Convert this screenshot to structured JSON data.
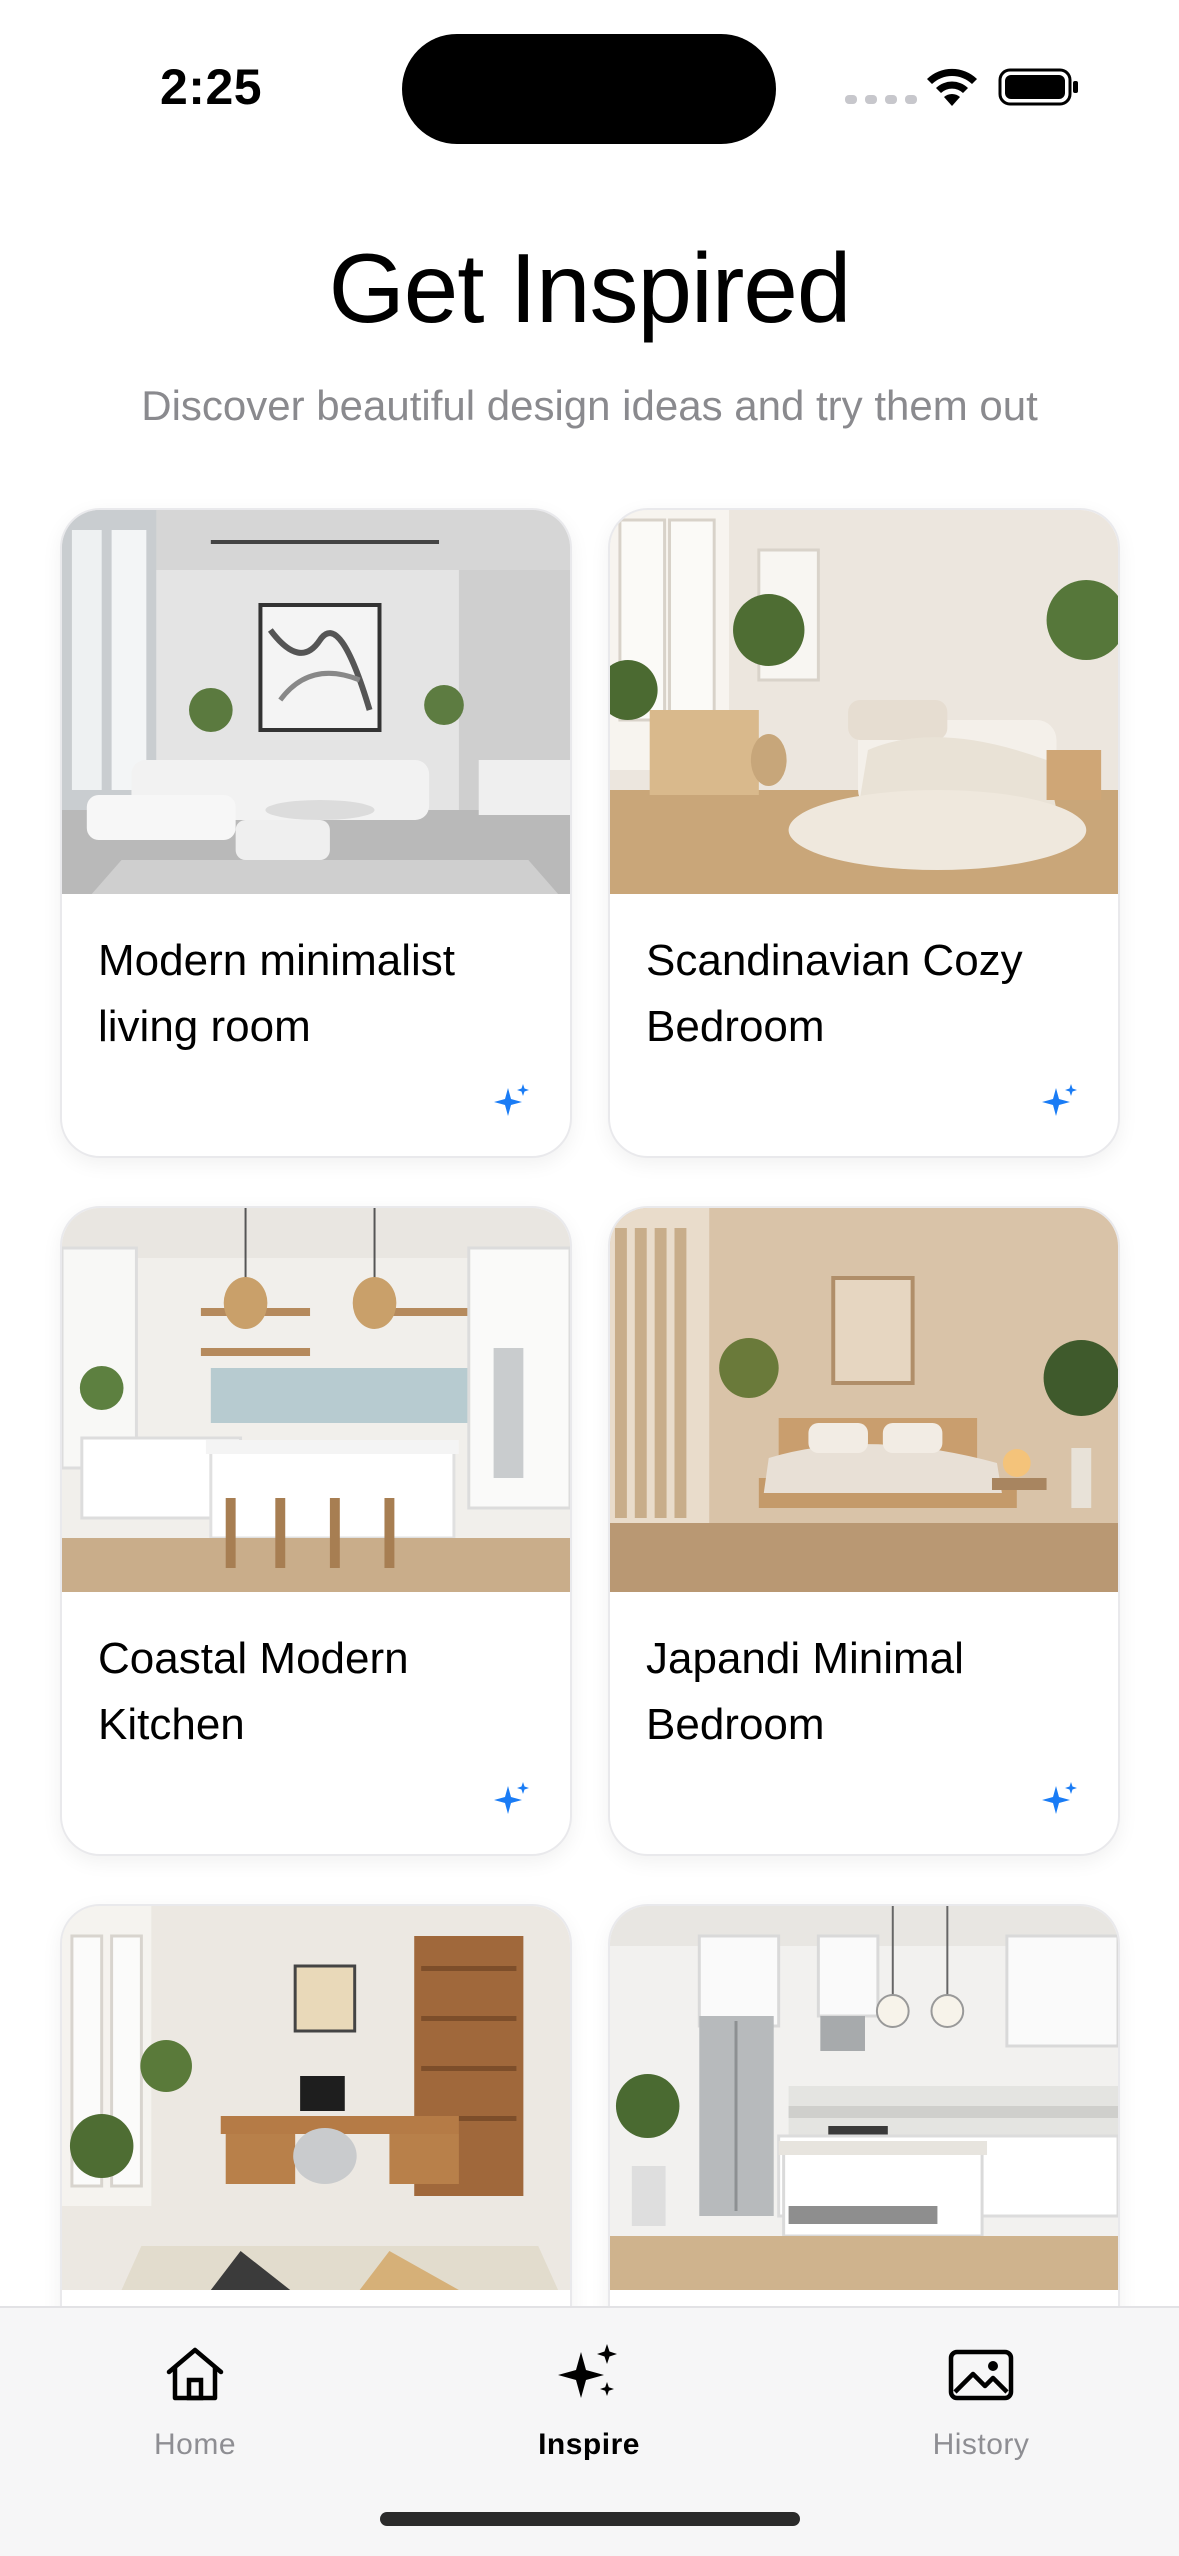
{
  "status_bar": {
    "time": "2:25"
  },
  "header": {
    "title": "Get Inspired",
    "subtitle": "Discover beautiful design ideas and try them out"
  },
  "cards": [
    {
      "title": "Modern minimalist living room",
      "image": "modern-minimalist-living-room-photo",
      "icon": "sparkle-icon"
    },
    {
      "title": "Scandinavian Cozy Bedroom",
      "image": "scandinavian-bedroom-photo",
      "icon": "sparkle-icon"
    },
    {
      "title": "Coastal Modern Kitchen",
      "image": "coastal-kitchen-photo",
      "icon": "sparkle-icon"
    },
    {
      "title": "Japandi Minimal Bedroom",
      "image": "japandi-bedroom-photo",
      "icon": "sparkle-icon"
    },
    {
      "title": "",
      "image": "home-office-photo",
      "icon": "sparkle-icon"
    },
    {
      "title": "",
      "image": "white-kitchen-photo",
      "icon": "sparkle-icon"
    }
  ],
  "tab_bar": {
    "tabs": [
      {
        "label": "Home",
        "icon": "house-icon",
        "active": false
      },
      {
        "label": "Inspire",
        "icon": "sparkles-icon",
        "active": true
      },
      {
        "label": "History",
        "icon": "photo-icon",
        "active": false
      }
    ]
  },
  "colors": {
    "accent": "#1a7cf5",
    "subtitle": "#8a8a8e",
    "inactive_tab": "#8e8e93",
    "tab_bar_bg": "#f6f6f7"
  }
}
